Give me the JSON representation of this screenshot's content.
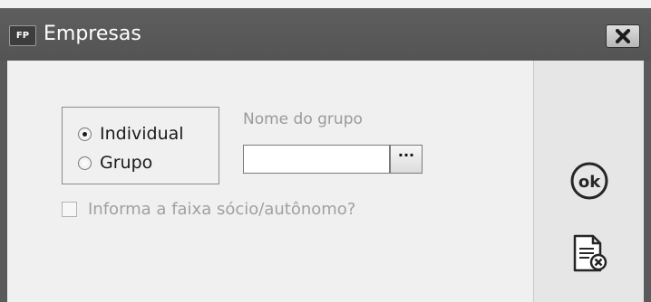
{
  "window": {
    "title": "Empresas",
    "icon_text": "FP"
  },
  "options": {
    "individual_label": "Individual",
    "grupo_label": "Grupo",
    "selected": "Individual"
  },
  "group_field": {
    "label": "Nome do grupo",
    "value": "",
    "lookup_label": "···"
  },
  "checkbox": {
    "label": "Informa a faixa sócio/autônomo?",
    "checked": false,
    "enabled": false
  },
  "side_buttons": {
    "ok_label": "ok",
    "ok_icon": "ok-circle-icon",
    "cancel_icon": "document-cancel-icon"
  },
  "colors": {
    "titlebar": "#585858",
    "panel": "#f0f0f0",
    "side_panel": "#e6e6e6",
    "disabled_text": "#a0a0a0"
  }
}
